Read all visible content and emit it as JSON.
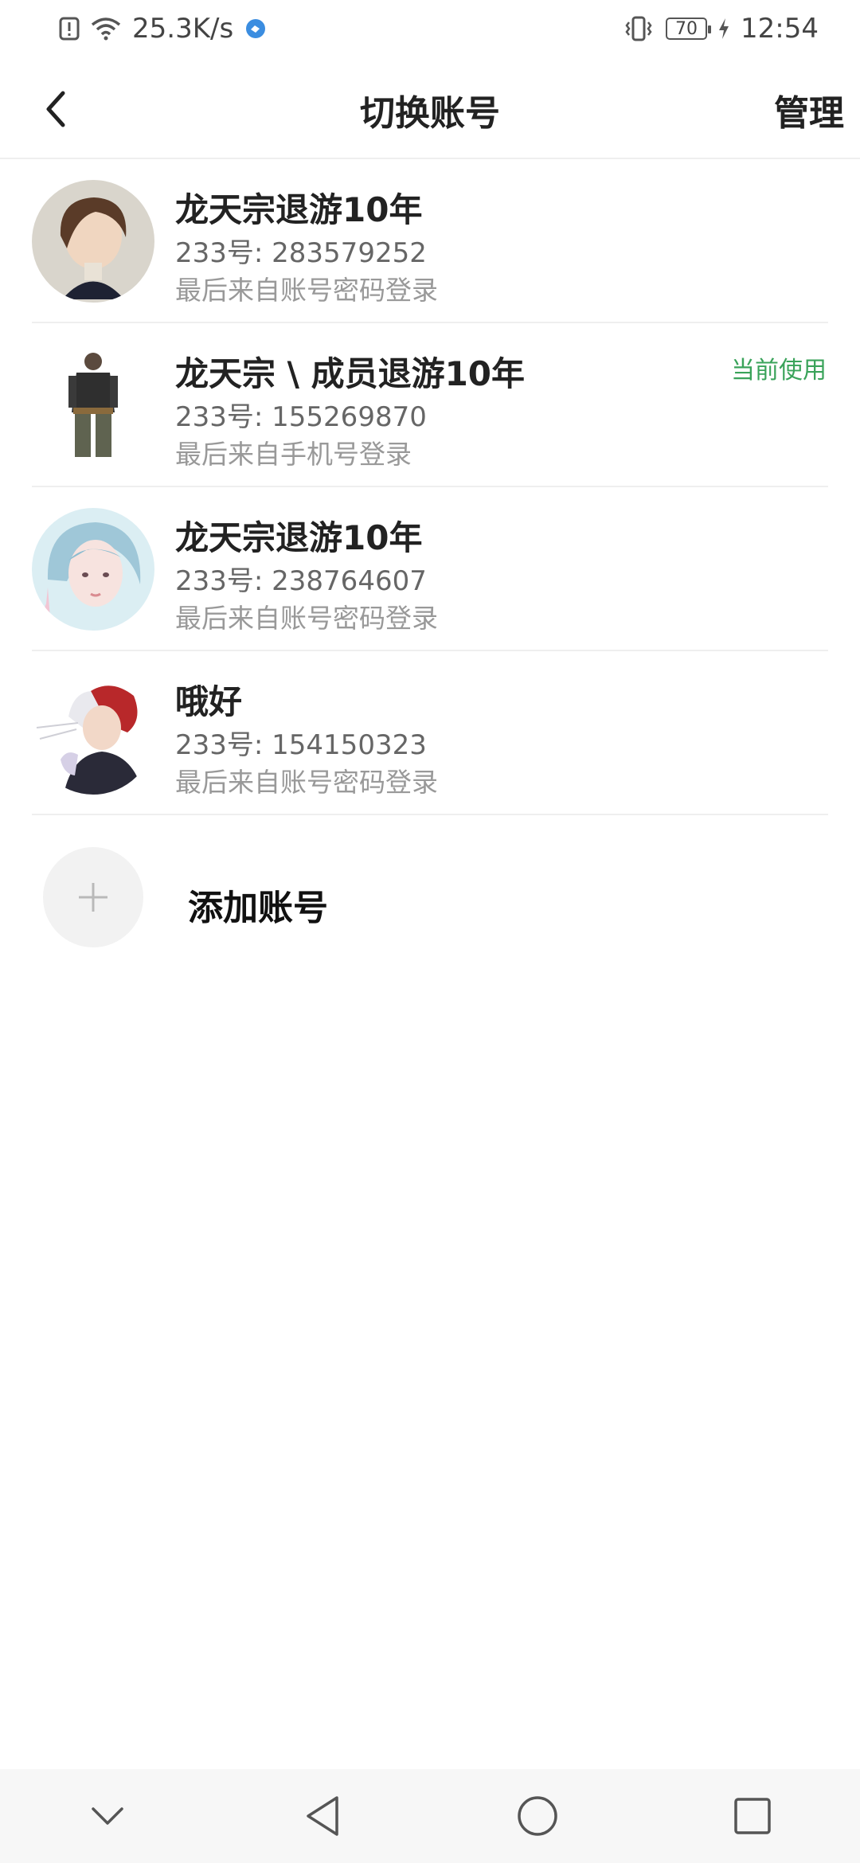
{
  "status_bar": {
    "speed": "25.3K/s",
    "battery": "70",
    "time": "12:54"
  },
  "header": {
    "title": "切换账号",
    "manage_label": "管理"
  },
  "accounts": [
    {
      "name": "龙天宗退游10年",
      "id_line": "233号: 283579252",
      "login_method": "最后来自账号密码登录",
      "current": ""
    },
    {
      "name": "龙天宗 \\ 成员退游10年",
      "id_line": "233号: 155269870",
      "login_method": "最后来自手机号登录",
      "current": "当前使用"
    },
    {
      "name": "龙天宗退游10年",
      "id_line": "233号: 238764607",
      "login_method": "最后来自账号密码登录",
      "current": ""
    },
    {
      "name": "哦好",
      "id_line": "233号: 154150323",
      "login_method": "最后来自账号密码登录",
      "current": ""
    }
  ],
  "add_account": {
    "label": "添加账号"
  },
  "colors": {
    "accent_green": "#3aa35a"
  }
}
